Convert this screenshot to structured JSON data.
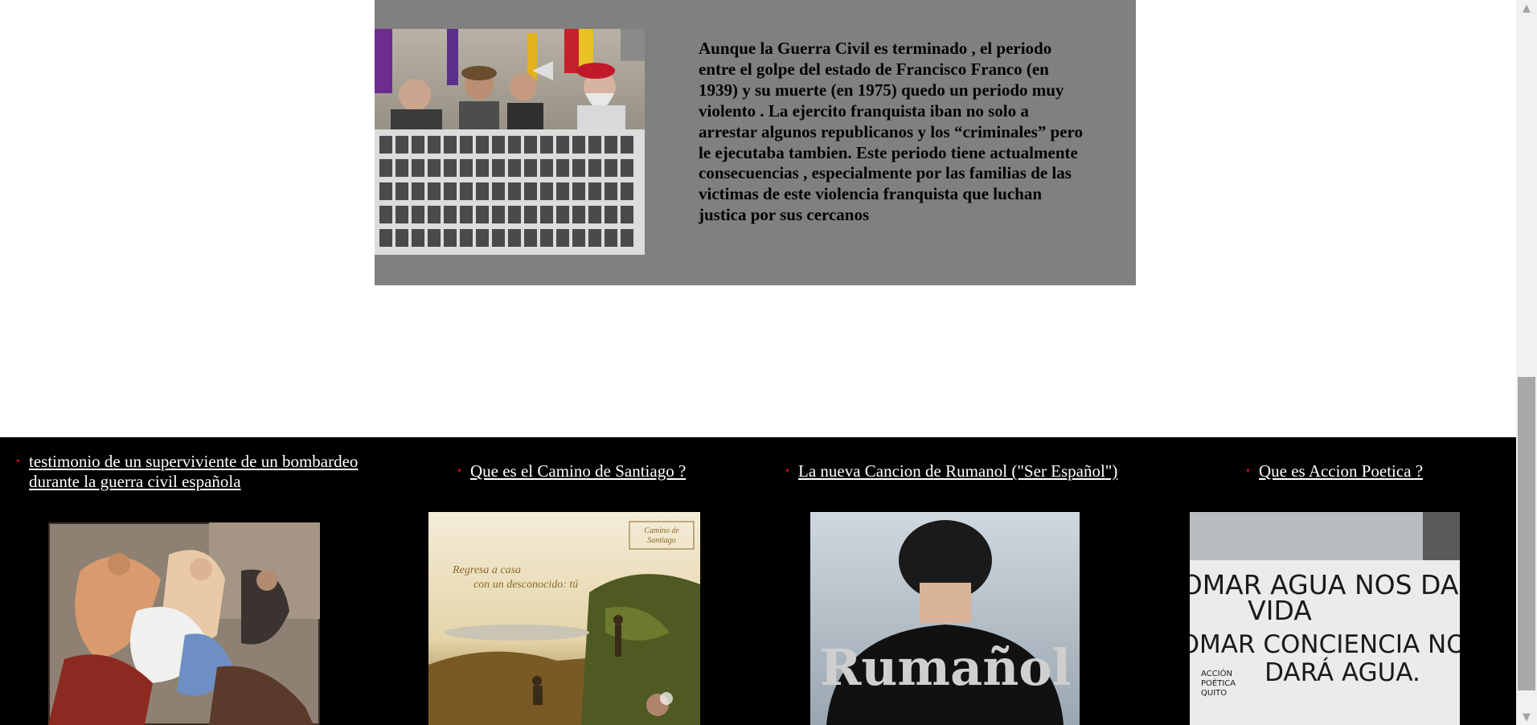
{
  "article": {
    "image_alt": "Protesta con pancarta de fotografías de víctimas",
    "paragraph": "Aunque la Guerra Civil es terminado , el periodo entre el golpe del estado de Francisco Franco (en 1939) y su muerte (en 1975) quedo un periodo muy violento . La ejercito franquista iban no solo a arrestar algunos republicanos y los “criminales” pero le ejecutaba tambien. Este periodo tiene actualmente consecuencias , especialmente por las familias de las victimas de este violencia franquista que luchan justica por sus cercanos"
  },
  "footer": {
    "items": [
      {
        "label": "testimonio de un superviviente de un bombardeo durante la guerra civil española",
        "bullet": "•"
      },
      {
        "label": "Que es el Camino de Santiago ?",
        "bullet": "•"
      },
      {
        "label": "La nueva Cancion de Rumanol (\"Ser Español\")",
        "bullet": "•"
      },
      {
        "label": "Que es Accion Poetica ?",
        "bullet": "•"
      }
    ],
    "camino_poster": {
      "slogan_line1": "Regresa a casa",
      "slogan_line2": "con un desconocido: tú",
      "logo_line1": "Camino de",
      "logo_line2": "Santiago"
    },
    "rumanol_shirt": {
      "text": "Rumañol"
    },
    "accion_wall": {
      "line1": "TOMAR AGUA NOS DA",
      "line2": "VIDA",
      "line3": "TOMAR CONCIENCIA NOS",
      "line4": "DARÁ AGUA.",
      "signature1": "ACCIÓN",
      "signature2": "POÉTICA",
      "signature3": "QUITO"
    }
  },
  "scrollbar": {
    "up": "▲",
    "down": "▼"
  }
}
